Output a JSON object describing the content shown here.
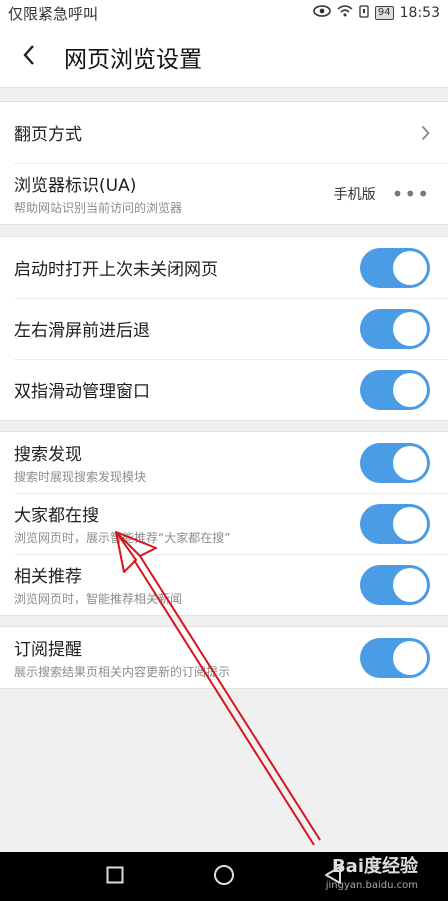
{
  "status_bar": {
    "carrier": "仅限紧急呼叫",
    "battery": "94",
    "time": "18:53"
  },
  "header": {
    "title": "网页浏览设置"
  },
  "groups": [
    {
      "items": [
        {
          "title": "翻页方式",
          "control": "chevron"
        },
        {
          "title": "浏览器标识(UA)",
          "subtitle": "帮助网站识别当前访问的浏览器",
          "value": "手机版",
          "control": "more"
        }
      ]
    },
    {
      "items": [
        {
          "title": "启动时打开上次未关闭网页",
          "control": "toggle",
          "on": true
        },
        {
          "title": "左右滑屏前进后退",
          "control": "toggle",
          "on": true
        },
        {
          "title": "双指滑动管理窗口",
          "control": "toggle",
          "on": true
        }
      ]
    },
    {
      "items": [
        {
          "title": "搜索发现",
          "subtitle": "搜索时展现搜索发现模块",
          "control": "toggle",
          "on": true
        },
        {
          "title": "大家都在搜",
          "subtitle": "浏览网页时，展示智能推荐“大家都在搜”",
          "control": "toggle",
          "on": true
        },
        {
          "title": "相关推荐",
          "subtitle": "浏览网页时，智能推荐相关新闻",
          "control": "toggle",
          "on": true
        }
      ]
    },
    {
      "items": [
        {
          "title": "订阅提醒",
          "subtitle": "展示搜索结果页相关内容更新的订阅提示",
          "control": "toggle",
          "on": true
        }
      ]
    }
  ],
  "watermark": {
    "brand": "Bai度经验",
    "url": "jingyan.baidu.com"
  },
  "colors": {
    "toggle_on": "#4a9de4",
    "annotation_arrow": "#d8141b"
  }
}
